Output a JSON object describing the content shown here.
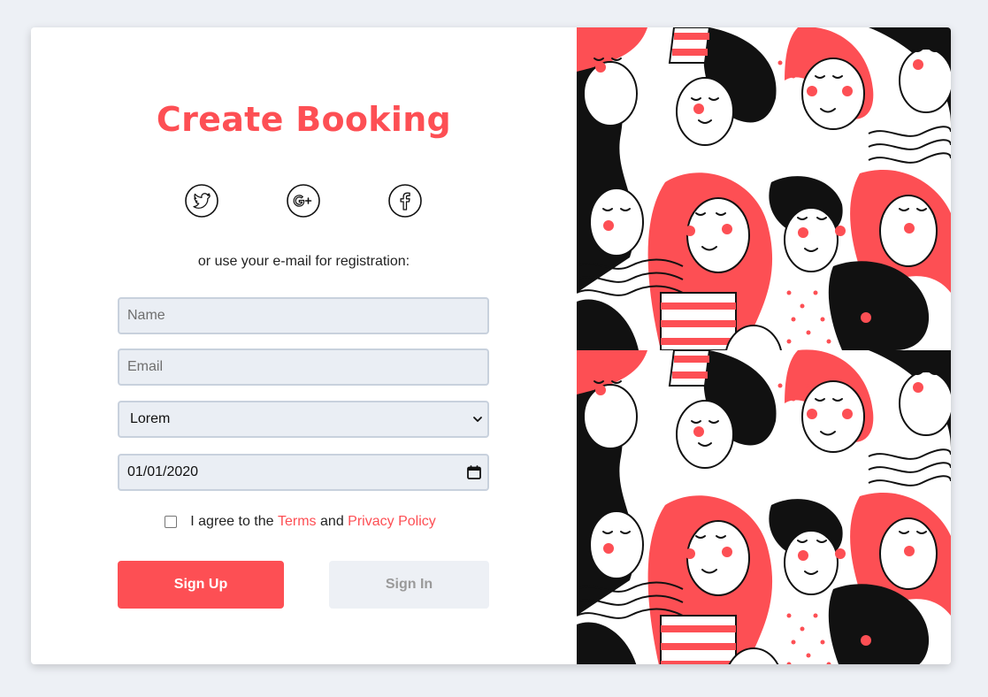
{
  "form": {
    "title": "Create Booking",
    "subtitle": "or use your e-mail for registration:",
    "name_placeholder": "Name",
    "email_placeholder": "Email",
    "select_value": "Lorem",
    "date_value": "01/01/2020",
    "agree_prefix": "I agree to the",
    "terms_label": "Terms",
    "and_label": "and",
    "privacy_label": "Privacy Policy",
    "signup_label": "Sign Up",
    "signin_label": "Sign In"
  },
  "social": [
    "twitter-icon",
    "google-plus-icon",
    "facebook-icon"
  ],
  "colors": {
    "accent": "#fd4f54",
    "background": "#edf0f5",
    "field_bg": "#eaeef4",
    "field_border": "#c8d1dd"
  }
}
